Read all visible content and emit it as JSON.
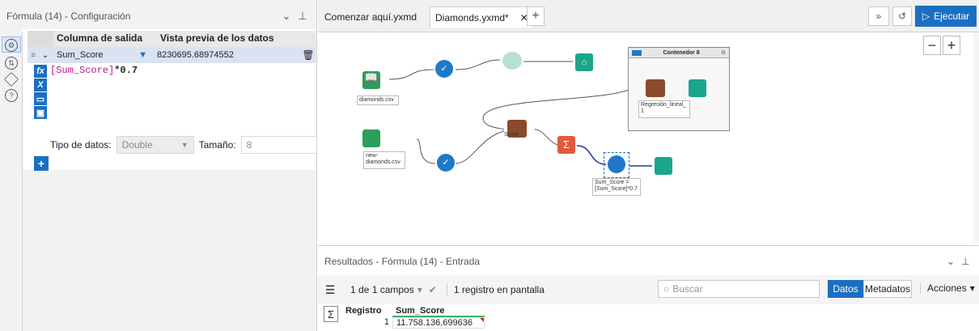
{
  "config": {
    "title": "Fórmula (14) - Configuración",
    "col_output": "Columna de salida",
    "col_preview": "Vista previa de los datos",
    "row_field": "Sum_Score",
    "row_value": "8230695.68974552",
    "expression_field": "[Sum_Score]",
    "expression_rest": "*0.7",
    "dtype_label": "Tipo de datos:",
    "dtype_value": "Double",
    "size_label": "Tamaño:",
    "size_value": "8"
  },
  "tabs": {
    "tab1": "Comenzar aquí.yxmd",
    "tab2": "Diamonds.yxmd*",
    "run": "Ejecutar"
  },
  "canvas": {
    "container_title": "Contenedor 8",
    "lbl_diamonds": "diamonds.csv",
    "lbl_new": "new-\ndiamonds.csv",
    "lbl_regression": "Regresión_lineal_\n1",
    "lbl_formula": "Sum_Score =\n[Sum_Score]*0.7",
    "lbl_score": "Score"
  },
  "results": {
    "title": "Resultados - Fórmula (14) - Entrada",
    "fields": "1 de 1 campos",
    "records": "1 registro en pantalla",
    "search_placeholder": "Buscar",
    "datos": "Datos",
    "metadatos": "Metadatos",
    "acciones": "Acciones",
    "headers": [
      "Registro",
      "Sum_Score"
    ],
    "rows": [
      [
        "1",
        "11.758.136,699636"
      ]
    ]
  },
  "colors": {
    "accent": "#1b6fc1",
    "green_node": "#2e9e5b",
    "blue_node": "#1f78c8",
    "teal_node": "#1aa68a",
    "orange_node": "#e05a3a",
    "brown_node": "#8a4b2c"
  }
}
